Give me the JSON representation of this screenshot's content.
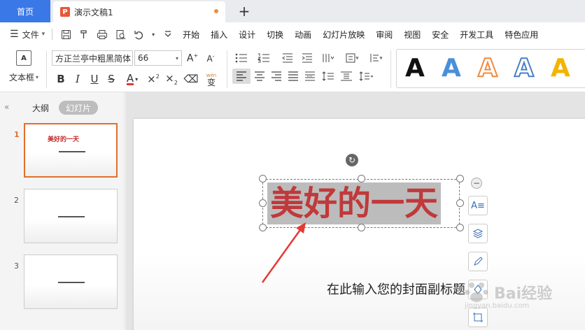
{
  "tabs": {
    "home": "首页",
    "document": "演示文稿1",
    "new_tab": "+"
  },
  "menubar": {
    "file": "文件",
    "items": [
      "开始",
      "插入",
      "设计",
      "切换",
      "动画",
      "幻灯片放映",
      "审阅",
      "视图",
      "安全",
      "开发工具",
      "特色应用"
    ]
  },
  "ribbon": {
    "textbox_label": "文本框",
    "textbox_icon": "A",
    "font_name": "方正兰亭中粗黑简体",
    "font_size": "66",
    "phonetic_label": "wén",
    "phonetic_char": "变",
    "wordart_styles": [
      {
        "letter": "A",
        "color": "#111111"
      },
      {
        "letter": "A",
        "color": "#4a90d9"
      },
      {
        "letter": "A",
        "color": "#f08a3c"
      },
      {
        "letter": "A",
        "color": "#4a7fc4"
      },
      {
        "letter": "A",
        "color": "#f2b400"
      }
    ]
  },
  "leftpanel": {
    "outline_tab": "大纲",
    "slides_tab": "幻灯片",
    "slides": [
      {
        "number": "1",
        "title": "美好的一天"
      },
      {
        "number": "2",
        "title": ""
      },
      {
        "number": "3",
        "title": ""
      }
    ]
  },
  "slide": {
    "title": "美好的一天",
    "subtitle": "在此输入您的封面副标题"
  },
  "watermark": {
    "text": "Bai经验",
    "url": "jingyan.baidu.com"
  },
  "colors": {
    "accent_blue": "#3b78e7",
    "active_orange": "#e0702a",
    "title_red": "#c0393b",
    "arrow_red": "#e53935"
  }
}
